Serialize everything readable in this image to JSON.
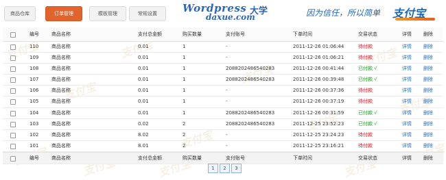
{
  "tabs": [
    {
      "label": "商品仓库",
      "active": false
    },
    {
      "label": "订单管理",
      "active": true
    },
    {
      "label": "模板管理",
      "active": false
    },
    {
      "label": "常规设置",
      "active": false
    }
  ],
  "brand": {
    "wordpress": "Wordpress",
    "daxue_text": "大学",
    "domain": "daxue.com"
  },
  "slogan": "因为信任，所以简单",
  "alipay_logo": "支付宝",
  "watermark_text": "支付宝",
  "columns": [
    "编号",
    "商品名称",
    "支付总金额",
    "购买数量",
    "支付账号",
    "下单时间",
    "交易状态",
    "详情",
    "删除"
  ],
  "rows": [
    {
      "id": "110",
      "name": "商品名称",
      "amount": "0.01",
      "qty": "1",
      "account": "-",
      "time": "2011-12-26 01:06:44",
      "status": "待付款",
      "paid": false
    },
    {
      "id": "109",
      "name": "商品名称",
      "amount": "0.01",
      "qty": "1",
      "account": "-",
      "time": "2011-12-26 01:06:21",
      "status": "待付款",
      "paid": false
    },
    {
      "id": "108",
      "name": "商品名称",
      "amount": "0.01",
      "qty": "1",
      "account": "2088202486540283",
      "time": "2011-12-26 00:41:44",
      "status": "已付款 √",
      "paid": true
    },
    {
      "id": "107",
      "name": "商品名称",
      "amount": "0.01",
      "qty": "1",
      "account": "2088202486540283",
      "time": "2011-12-26 00:39:48",
      "status": "已付款 √",
      "paid": true
    },
    {
      "id": "106",
      "name": "商品名称",
      "amount": "0.01",
      "qty": "1",
      "account": "-",
      "time": "2011-12-26 00:37:36",
      "status": "待付款",
      "paid": false
    },
    {
      "id": "105",
      "name": "商品名称",
      "amount": "0.01",
      "qty": "1",
      "account": "-",
      "time": "2011-12-26 00:37:19",
      "status": "待付款",
      "paid": false
    },
    {
      "id": "104",
      "name": "商品名称",
      "amount": "0.01",
      "qty": "1",
      "account": "2088202486540283",
      "time": "2011-12-26 00:31:59",
      "status": "已付款 √",
      "paid": true
    },
    {
      "id": "103",
      "name": "商品名称",
      "amount": "0.02",
      "qty": "2",
      "account": "2088202486540283",
      "time": "2011-12-25 23:52:23",
      "status": "已付款 √",
      "paid": true
    },
    {
      "id": "102",
      "name": "商品名称",
      "amount": "8.02",
      "qty": "2",
      "account": "-",
      "time": "2011-12-25 23:24:23",
      "status": "待付款",
      "paid": false
    },
    {
      "id": "101",
      "name": "商品名称",
      "amount": "8.01",
      "qty": "2",
      "account": "-",
      "time": "2011-12-25 23:16:21",
      "status": "待付款",
      "paid": false
    }
  ],
  "row_actions": {
    "detail": "详情",
    "delete": "删除"
  },
  "pagination": [
    "1",
    "2",
    "3"
  ],
  "colors": {
    "accent": "#e0642b",
    "unpaid": "#e0141e",
    "paid": "#179b1c",
    "link": "#2a6fc0"
  }
}
